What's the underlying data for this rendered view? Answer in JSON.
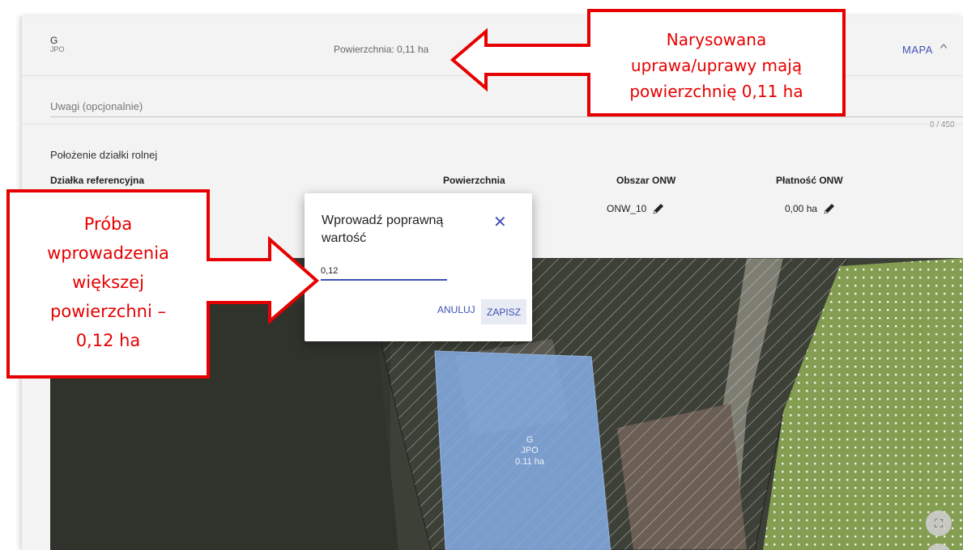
{
  "crop": {
    "code": "G",
    "group": "JPO"
  },
  "area_label": "Powierzchnia: 0,11 ha",
  "map_link": "MAPA",
  "notes": {
    "placeholder": "Uwagi (opcjonalnie)",
    "counter": "0 / 450"
  },
  "section_title": "Położenie działki rolnej",
  "table": {
    "headers": [
      "Działka referencyjna",
      "Powierzchnia",
      "Obszar ONW",
      "Płatność ONW"
    ],
    "row": {
      "onw_area": "ONW_10",
      "onw_payment": "0,00 ha"
    }
  },
  "map": {
    "parcel_label": [
      "G",
      "JPO",
      "0.11 ha"
    ],
    "fullscreen_icon": "fullscreen-icon",
    "zoom_icon": "plus-icon"
  },
  "dialog": {
    "title": "Wprowadź poprawną wartość",
    "value": "0,12",
    "cancel": "ANULUJ",
    "save": "ZAPISZ"
  },
  "callouts": {
    "right": [
      "Narysowana",
      "uprawa/uprawy mają",
      "powierzchnię 0,11 ha"
    ],
    "left": [
      "Próba",
      "wprowadzenia",
      "większej",
      "powierzchni –",
      "0,12 ha"
    ]
  },
  "colors": {
    "accent": "#3f51b5",
    "callout": "#e60000",
    "parcel": "#7fa7e0",
    "neighbor": "#a8c46a"
  }
}
